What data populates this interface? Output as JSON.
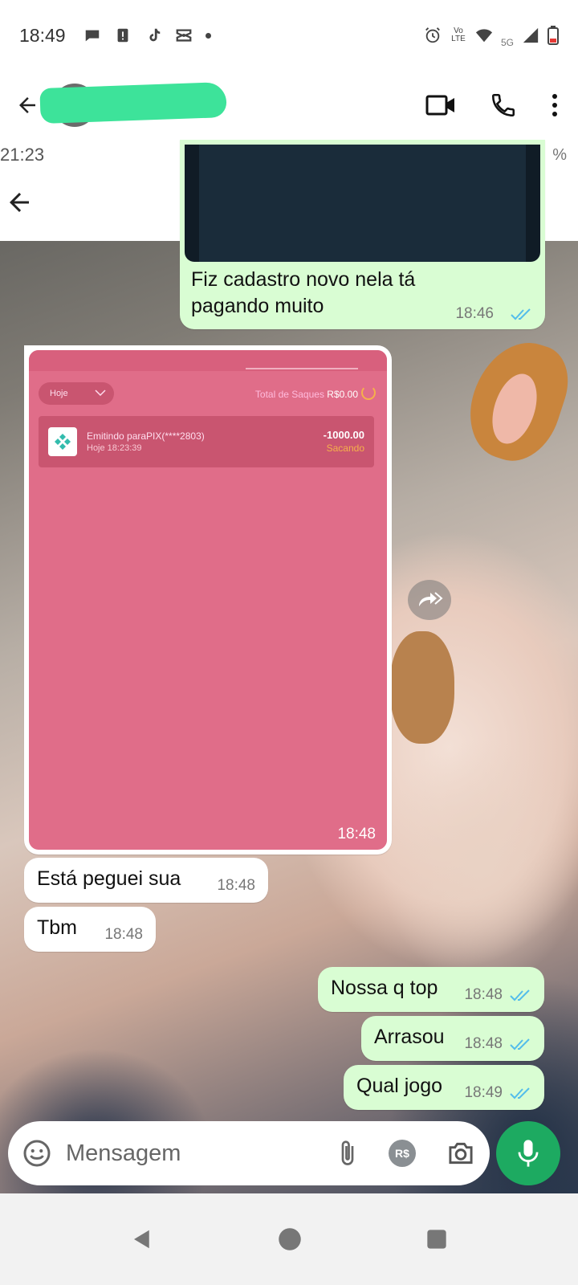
{
  "status_bar": {
    "time": "18:49",
    "network": "5G",
    "volte": "Vo LTE"
  },
  "header": {
    "contact_name": "",
    "icons": [
      "back-arrow-icon",
      "video-call-icon",
      "voice-call-icon",
      "more-options-icon"
    ]
  },
  "embedded_screenshot": {
    "time": "21:23",
    "battery_fragment": "%"
  },
  "messages": [
    {
      "id": "m1",
      "direction": "out",
      "type": "image",
      "caption": "Fiz cadastro novo nela tá pagando muito",
      "time": "18:46",
      "read": true
    },
    {
      "id": "m2",
      "direction": "in",
      "type": "image",
      "time": "18:48",
      "image_content": {
        "filter": "Hoje",
        "total_label": "Total de Saques",
        "total_value": "R$0.00",
        "entry_title": "Emitindo paraPIX(****2803)",
        "entry_date": "Hoje 18:23:39",
        "entry_amount": "-1000.00",
        "entry_status": "Sacando"
      }
    },
    {
      "id": "m3",
      "direction": "in",
      "type": "text",
      "text": "Está peguei sua",
      "time": "18:48"
    },
    {
      "id": "m4",
      "direction": "in",
      "type": "text",
      "text": "Tbm",
      "time": "18:48"
    },
    {
      "id": "m5",
      "direction": "out",
      "type": "text",
      "text": "Nossa q top",
      "time": "18:48",
      "read": true
    },
    {
      "id": "m6",
      "direction": "out",
      "type": "text",
      "text": "Arrasou",
      "time": "18:48",
      "read": true
    },
    {
      "id": "m7",
      "direction": "out",
      "type": "text",
      "text": "Qual jogo",
      "time": "18:49",
      "read": true
    }
  ],
  "input_bar": {
    "placeholder": "Mensagem",
    "payment_label": "R$"
  },
  "colors": {
    "outgoing_bubble": "#d9fdd3",
    "incoming_bubble": "#ffffff",
    "accent_green": "#1daa61",
    "read_ticks": "#53bdeb",
    "pink_screen": "#e06d89"
  }
}
